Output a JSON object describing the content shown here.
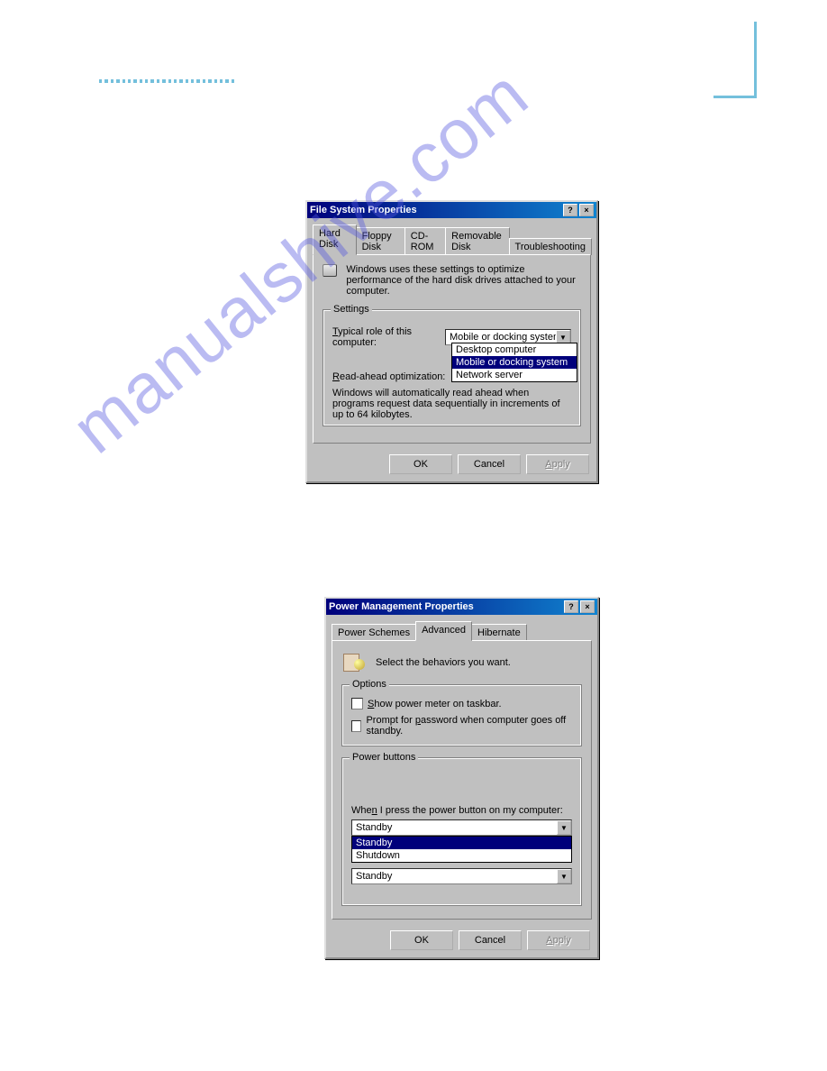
{
  "watermark": "manualshive.com",
  "dialog1": {
    "title": "File System Properties",
    "tabs": [
      "Hard Disk",
      "Floppy Disk",
      "CD-ROM",
      "Removable Disk",
      "Troubleshooting"
    ],
    "active_tab": "Hard Disk",
    "desc": "Windows uses these settings to optimize performance of the hard disk drives attached to your computer.",
    "group_label": "Settings",
    "role_label": "Typical role of this computer:",
    "role_value": "Mobile or docking system",
    "dropdown_options": [
      "Desktop computer",
      "Mobile or docking system",
      "Network server"
    ],
    "dropdown_selected": "Mobile or docking system",
    "readahead_label": "Read-ahead optimization:",
    "note": "Windows will automatically read ahead when programs request data sequentially in increments of up to 64 kilobytes.",
    "buttons": {
      "ok": "OK",
      "cancel": "Cancel",
      "apply": "Apply"
    }
  },
  "dialog2": {
    "title": "Power Management Properties",
    "tabs": [
      "Power Schemes",
      "Advanced",
      "Hibernate"
    ],
    "active_tab": "Advanced",
    "desc": "Select the behaviors you want.",
    "options_label": "Options",
    "opt1": "Show power meter on taskbar.",
    "opt2": "Prompt for password when computer goes off standby.",
    "pb_label": "Power buttons",
    "pb_prompt": "When I press the power button on my computer:",
    "pb_value": "Standby",
    "pb_options": [
      "Standby",
      "Shutdown"
    ],
    "pb_selected": "Standby",
    "pb_value2": "Standby",
    "buttons": {
      "ok": "OK",
      "cancel": "Cancel",
      "apply": "Apply"
    }
  }
}
